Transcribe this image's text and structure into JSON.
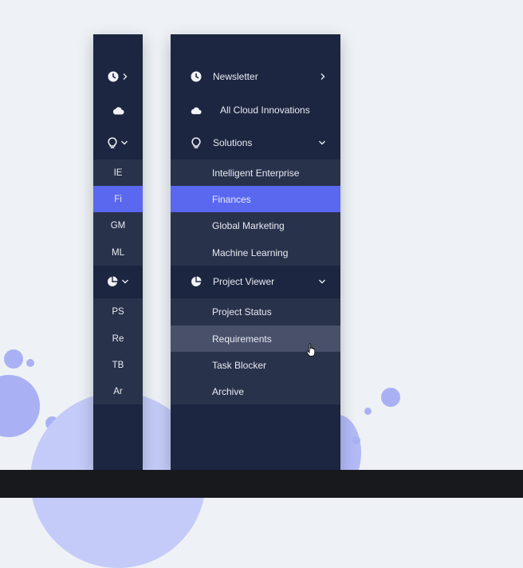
{
  "collapsed_nav": {
    "items": [
      {
        "icon": "clock-icon",
        "indicator": "chevron-right"
      },
      {
        "icon": "cloud-icon"
      },
      {
        "icon": "lightbulb-icon",
        "indicator": "chevron-down"
      },
      {
        "abbr": "IE"
      },
      {
        "abbr": "Fi",
        "selected": true
      },
      {
        "abbr": "GM"
      },
      {
        "abbr": "ML"
      },
      {
        "icon": "pie-chart-icon",
        "indicator": "chevron-down"
      },
      {
        "abbr": "PS"
      },
      {
        "abbr": "Re"
      },
      {
        "abbr": "TB"
      },
      {
        "abbr": "Ar"
      }
    ]
  },
  "expanded_nav": {
    "newsletter": "Newsletter",
    "all_cloud": "All Cloud Innovations",
    "solutions": "Solutions",
    "solutions_children": [
      "Intelligent Enterprise",
      "Finances",
      "Global Marketing",
      "Machine Learning"
    ],
    "project_viewer": "Project Viewer",
    "project_children": [
      "Project Status",
      "Requirements",
      "Task Blocker",
      "Archive"
    ]
  },
  "colors": {
    "nav_bg": "#1c2640",
    "subitem_bg": "#28324b",
    "selected": "#5a68ef",
    "hover": "#48506a",
    "page_bg": "#eef2f6"
  }
}
